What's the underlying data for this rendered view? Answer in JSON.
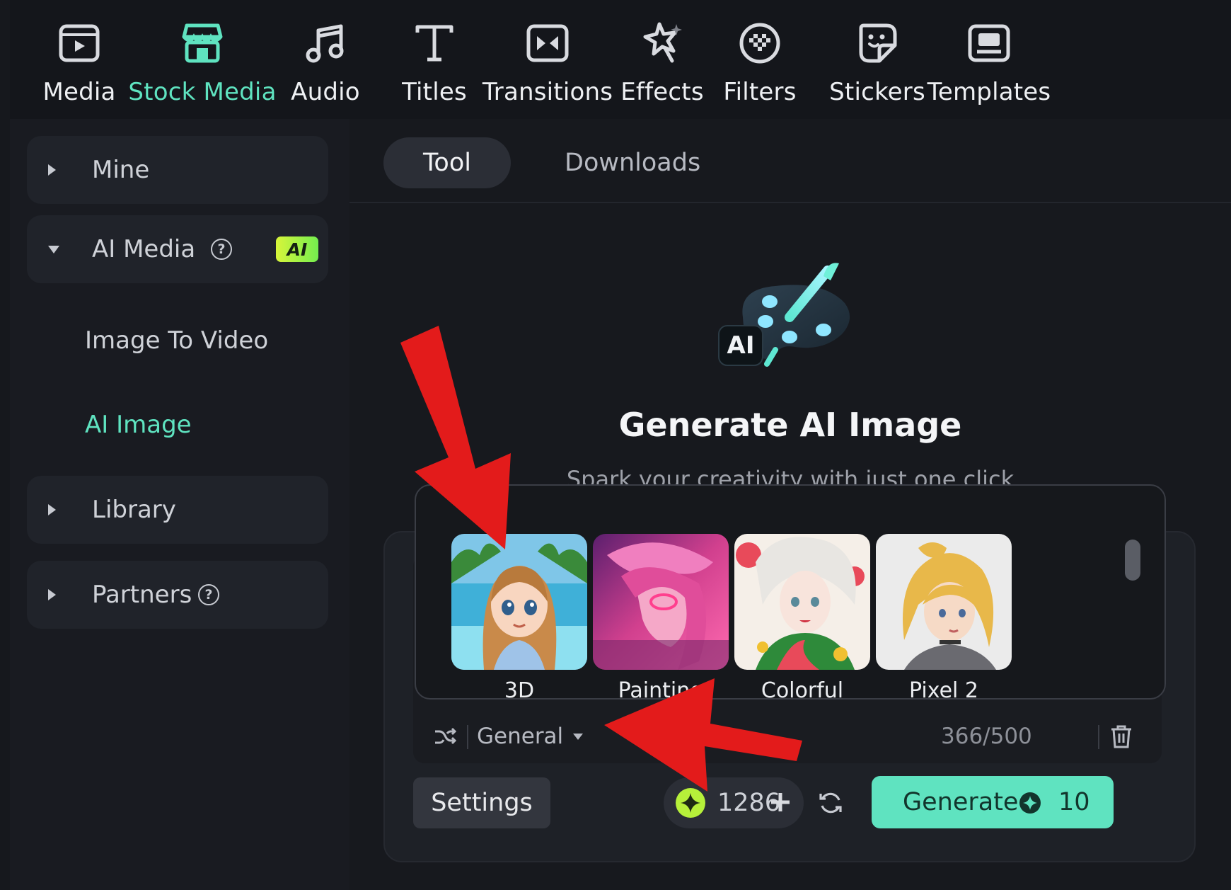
{
  "toolbar": {
    "tabs": [
      {
        "label": "Media",
        "icon": "media-icon"
      },
      {
        "label": "Stock Media",
        "icon": "store-icon",
        "active": true
      },
      {
        "label": "Audio",
        "icon": "music-note-icon"
      },
      {
        "label": "Titles",
        "icon": "text-t-icon"
      },
      {
        "label": "Transitions",
        "icon": "transition-icon"
      },
      {
        "label": "Effects",
        "icon": "sparkle-star-icon"
      },
      {
        "label": "Filters",
        "icon": "filter-circle-icon"
      },
      {
        "label": "Stickers",
        "icon": "sticker-smile-icon"
      },
      {
        "label": "Templates",
        "icon": "template-icon"
      }
    ],
    "accent": "#5fe3c0"
  },
  "sidebar": {
    "mine": "Mine",
    "ai_media": "AI Media",
    "ai_badge": "AI",
    "image_to_video": "Image To Video",
    "ai_image": "AI Image",
    "library": "Library",
    "partners": "Partners"
  },
  "main": {
    "tab_tool": "Tool",
    "tab_downloads": "Downloads",
    "hero_title": "Generate AI Image",
    "hero_subtitle": "Spark your creativity with just one click",
    "hero_icon_badge": "AI",
    "styles": [
      {
        "label": "3D"
      },
      {
        "label": "Painting"
      },
      {
        "label": "Colorful"
      },
      {
        "label": "Pixel 2"
      }
    ],
    "style_select": "General",
    "char_count": "366/500",
    "settings_label": "Settings",
    "credits": "1286",
    "generate_label": "Generate",
    "generate_cost": "10"
  },
  "colors": {
    "accent": "#5fe3c0",
    "annotation_arrow": "#e31b1b",
    "background": "#17191e"
  }
}
